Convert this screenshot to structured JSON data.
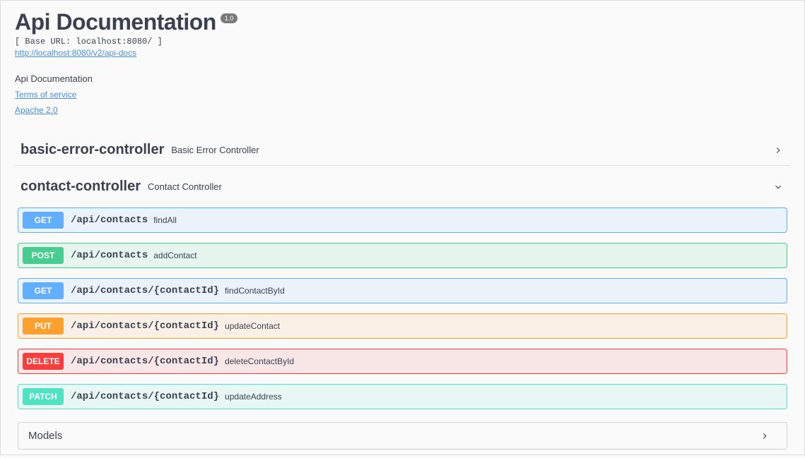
{
  "header": {
    "title": "Api Documentation",
    "version": "1.0",
    "base_url_label": "[ Base URL: localhost:8080/ ]",
    "api_docs_url": "http://localhost:8080/v2/api-docs",
    "description": "Api Documentation",
    "terms_link": "Terms of service",
    "license_link": "Apache 2.0"
  },
  "tags": [
    {
      "name": "basic-error-controller",
      "description": "Basic Error Controller",
      "expanded": false
    },
    {
      "name": "contact-controller",
      "description": "Contact Controller",
      "expanded": true
    }
  ],
  "ops": [
    {
      "method": "GET",
      "methodClass": "get",
      "path": "/api/contacts",
      "summary": "findAll"
    },
    {
      "method": "POST",
      "methodClass": "post",
      "path": "/api/contacts",
      "summary": "addContact"
    },
    {
      "method": "GET",
      "methodClass": "get",
      "path": "/api/contacts/{contactId}",
      "summary": "findContactById"
    },
    {
      "method": "PUT",
      "methodClass": "put",
      "path": "/api/contacts/{contactId}",
      "summary": "updateContact"
    },
    {
      "method": "DELETE",
      "methodClass": "delete",
      "path": "/api/contacts/{contactId}",
      "summary": "deleteContactById"
    },
    {
      "method": "PATCH",
      "methodClass": "patch",
      "path": "/api/contacts/{contactId}",
      "summary": "updateAddress"
    }
  ],
  "models": {
    "title": "Models"
  }
}
